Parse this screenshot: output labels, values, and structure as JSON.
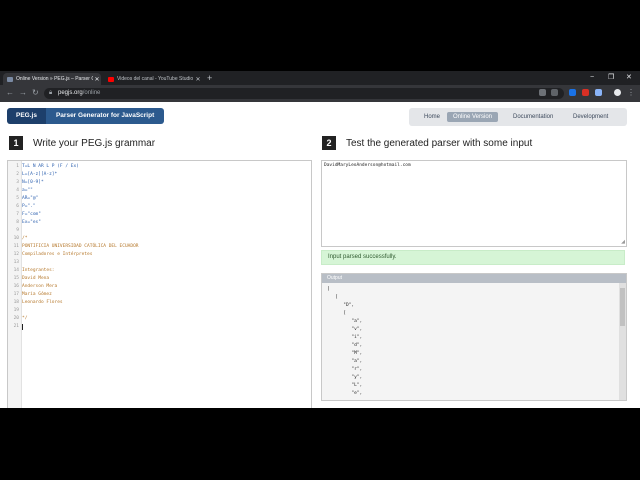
{
  "browser": {
    "tabs": [
      {
        "title": "Online Version » PEG.js – Parser G",
        "active": true,
        "icon": "pegjs-favicon"
      },
      {
        "title": "Videos del canal - YouTube Studio",
        "active": false,
        "icon": "youtube-favicon"
      }
    ],
    "new_tab": "+",
    "window_controls": {
      "minimize": "−",
      "restore": "❐",
      "close": "✕"
    },
    "nav": {
      "back": "←",
      "forward": "→",
      "reload": "↻"
    },
    "url": {
      "host": "pegjs.org",
      "path": "/online"
    },
    "colors": {
      "tabstrip": "#202124",
      "toolbar": "#35363a"
    }
  },
  "site": {
    "logo": {
      "short": "PEG.js",
      "long": "Parser Generator for JavaScript"
    },
    "nav": [
      "Home",
      "Online Version",
      "Documentation",
      "Development"
    ],
    "nav_active": "Online Version"
  },
  "step1": {
    "number": "1",
    "title": "Write your PEG.js grammar"
  },
  "step2": {
    "number": "2",
    "title": "Test the generated parser with some input"
  },
  "editor": {
    "lines": [
      {
        "n": "1",
        "text": "T=L N AR L P (F / Ex)"
      },
      {
        "n": "2",
        "text": "L=[A-z][A-z]*"
      },
      {
        "n": "3",
        "text": "N=[0-9]*"
      },
      {
        "n": "4",
        "text": "a=\"\""
      },
      {
        "n": "5",
        "text": "AR=\"@\""
      },
      {
        "n": "6",
        "text": "P=\".\""
      },
      {
        "n": "7",
        "text": "F=\"com\""
      },
      {
        "n": "8",
        "text": "Ex=\"es\""
      },
      {
        "n": "9",
        "text": ""
      },
      {
        "n": "10",
        "text": "/*"
      },
      {
        "n": "11",
        "text": "PONTIFICIA UNIVERSIDAD CATÓLICA DEL ECUADOR"
      },
      {
        "n": "12",
        "text": "Compiladores e Intérpretes"
      },
      {
        "n": "13",
        "text": ""
      },
      {
        "n": "14",
        "text": "Integrantes:"
      },
      {
        "n": "15",
        "text": "David Mena"
      },
      {
        "n": "16",
        "text": "Anderson Mera"
      },
      {
        "n": "17",
        "text": "María Gómez"
      },
      {
        "n": "18",
        "text": "Leonardo Flores"
      },
      {
        "n": "19",
        "text": ""
      },
      {
        "n": "20",
        "text": "*/"
      },
      {
        "n": "21",
        "text": ""
      }
    ],
    "colors": {
      "code": "#2b5fae",
      "comment": "#b5772a"
    }
  },
  "input": {
    "value": "DavidMaryLeoAnderson@hotmail.com"
  },
  "status": {
    "text": "Input parsed successfully.",
    "color": "#d6f5d6"
  },
  "output": {
    "header": "Output",
    "lines": [
      "[",
      "   [",
      "      \"D\",",
      "      [",
      "         \"a\",",
      "         \"v\",",
      "         \"i\",",
      "         \"d\",",
      "         \"M\",",
      "         \"a\",",
      "         \"r\",",
      "         \"y\",",
      "         \"L\",",
      "         \"e\","
    ]
  }
}
